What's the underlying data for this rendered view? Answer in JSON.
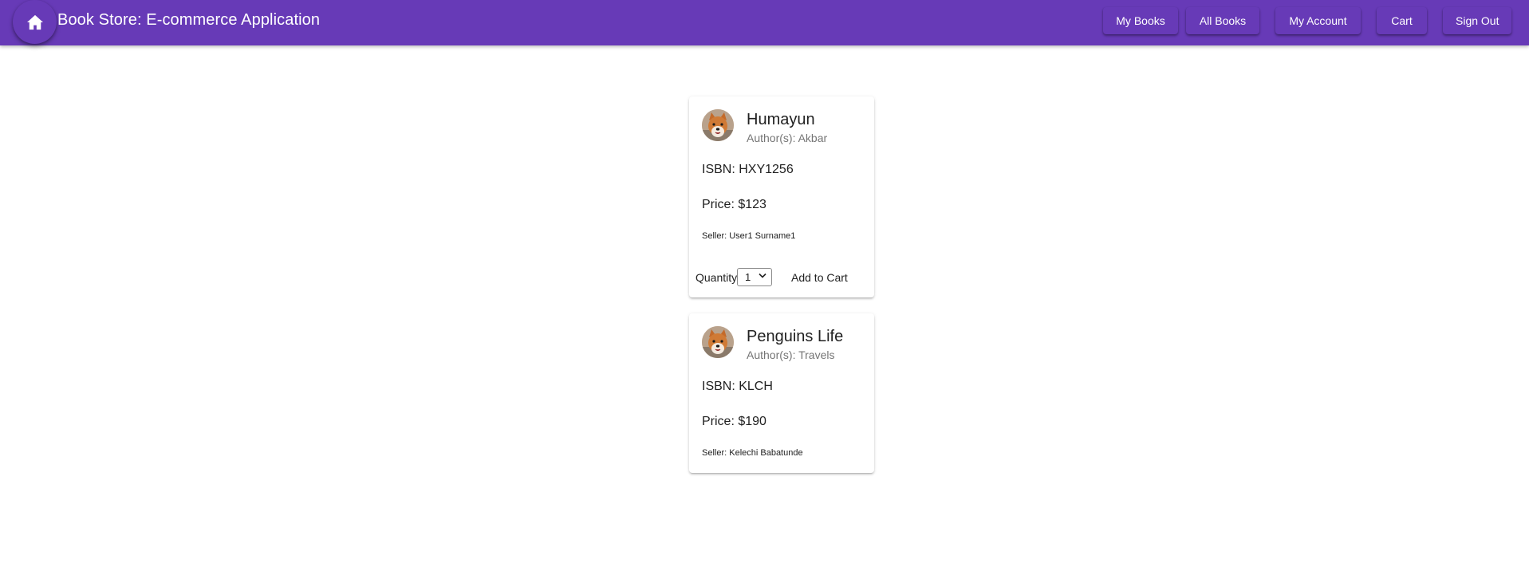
{
  "app": {
    "title": "Book Store: E-commerce Application",
    "home_icon": "home-icon",
    "brand_color": "#673ab7"
  },
  "nav": {
    "my_books": "My Books",
    "all_books": "All Books",
    "my_account": "My Account",
    "cart": "Cart",
    "sign_out": "Sign Out"
  },
  "books": [
    {
      "title": "Humayun",
      "authors": "Author(s): Akbar",
      "isbn": "ISBN: HXY1256",
      "price": "Price: $123",
      "seller": "Seller: User1 Surname1",
      "quantity_label": "Quantity",
      "quantity_value": "1",
      "add_to_cart": "Add to Cart"
    },
    {
      "title": "Penguins Life",
      "authors": "Author(s): Travels",
      "isbn": "ISBN: KLCH",
      "price": "Price: $190",
      "seller": "Seller: Kelechi Babatunde"
    }
  ]
}
